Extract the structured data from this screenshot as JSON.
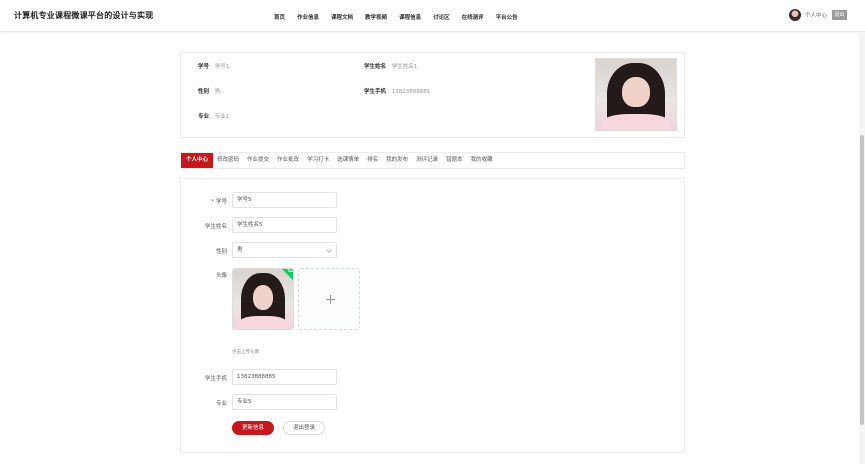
{
  "header": {
    "brand": "计算机专业课程微课平台的设计与实现",
    "nav": [
      "首页",
      "作业信息",
      "课程文档",
      "教学视频",
      "课程信息",
      "讨论区",
      "在线测评",
      "平台公告"
    ],
    "user_center": "个人中心",
    "logout": "退出"
  },
  "profile": {
    "student_id_label": "学号",
    "student_id_value": "学号1",
    "student_name_label": "学生姓名",
    "student_name_value": "学生姓名1",
    "gender_label": "性别",
    "gender_value": "男",
    "phone_label": "学生手机",
    "phone_value": "13823888881",
    "major_label": "专业",
    "major_value": "专业1"
  },
  "tabs": [
    "个人中心",
    "修改密码",
    "作业提交",
    "作业批改",
    "学习打卡",
    "选课情单",
    "排名",
    "我的发布",
    "测评记录",
    "错题本",
    "我的收藏"
  ],
  "form": {
    "student_id_label": "学号",
    "student_id_value": "学号5",
    "student_name_label": "学生姓名",
    "student_name_value": "学生姓名5",
    "gender_label": "性别",
    "gender_value": "男",
    "avatar_label": "头像",
    "upload_hint": "点击上传头像",
    "phone_label": "学生手机",
    "phone_value": "13823888885",
    "major_label": "专业",
    "major_value": "专业5",
    "update_button": "更新信息",
    "logout_button": "退出登录"
  },
  "colors": {
    "accent": "#c8161d",
    "success": "#13ce66"
  },
  "icons": [
    "user-avatar-icon",
    "chevron-down-icon",
    "plus-icon",
    "check-icon"
  ]
}
